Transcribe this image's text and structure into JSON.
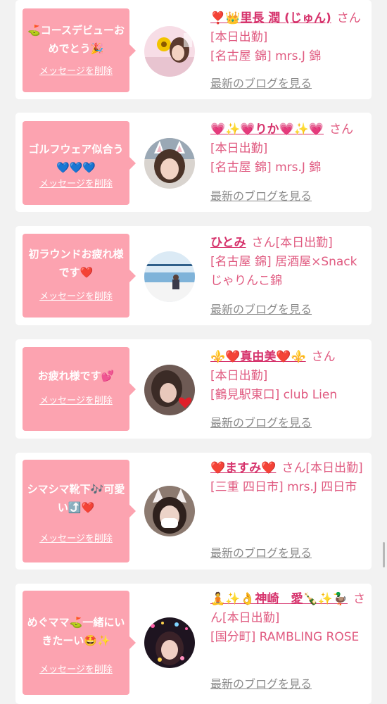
{
  "messages": [
    {
      "message": "⛳コースデビューおめでとう🎉",
      "delete_label": "メッセージを削除",
      "cast_name": "❣️👑里長 潤 (じゅん)",
      "honorific": "さん",
      "status": "[本日出勤]",
      "shop": "[名古屋 錦] mrs.J 錦",
      "blog_label": "最新のブログを見る",
      "avatar_icon": "cast-photo-flower-selfie"
    },
    {
      "message": "ゴルフウェア似合う💙💙💙",
      "delete_label": "メッセージを削除",
      "cast_name": "💗✨💗りか💗✨💗",
      "honorific": "さん",
      "status": "[本日出勤]",
      "shop": "[名古屋 錦] mrs.J 錦",
      "blog_label": "最新のブログを見る",
      "avatar_icon": "cast-photo-cat-ears"
    },
    {
      "message": "初ラウンドお疲れ様です❤️",
      "delete_label": "メッセージを削除",
      "cast_name": "ひとみ",
      "honorific": "さん",
      "status": "[本日出勤]",
      "shop": "[名古屋 錦] 居酒屋×Snack じゃりんこ錦",
      "blog_label": "最新のブログを見る",
      "avatar_icon": "cast-photo-ocean"
    },
    {
      "message": "お疲れ様です💕",
      "delete_label": "メッセージを削除",
      "cast_name": "⚜️❤️真由美❤️⚜️",
      "honorific": "さん",
      "status": "[本日出勤]",
      "shop": "[鶴見駅東口] club Lien",
      "blog_label": "最新のブログを見る",
      "avatar_icon": "cast-photo-heart"
    },
    {
      "message": "シマシマ靴下🎶可愛い⤴️❤️",
      "delete_label": "メッセージを削除",
      "cast_name": "❤️ますみ❤️",
      "honorific": "さん",
      "status": "[本日出勤]",
      "shop": "[三重 四日市] mrs.J 四日市",
      "blog_label": "最新のブログを見る",
      "avatar_icon": "cast-photo-mask-cat-ears"
    },
    {
      "message": "めぐママ⛳一緒にいきたーい🤩✨",
      "delete_label": "メッセージを削除",
      "cast_name": "🧘✨👌神崎　愛🍾✨🦆",
      "honorific": "さん",
      "status": "[本日出勤]",
      "shop": "[国分町] RAMBLING ROSE",
      "blog_label": "最新のブログを見る",
      "avatar_icon": "cast-photo-night-lights"
    }
  ],
  "colors": {
    "message_box": "#fca3b0",
    "name": "#d6336c",
    "info_text": "#e05a80",
    "link_gray": "#8a8a8a",
    "background": "#f2f2f2"
  }
}
